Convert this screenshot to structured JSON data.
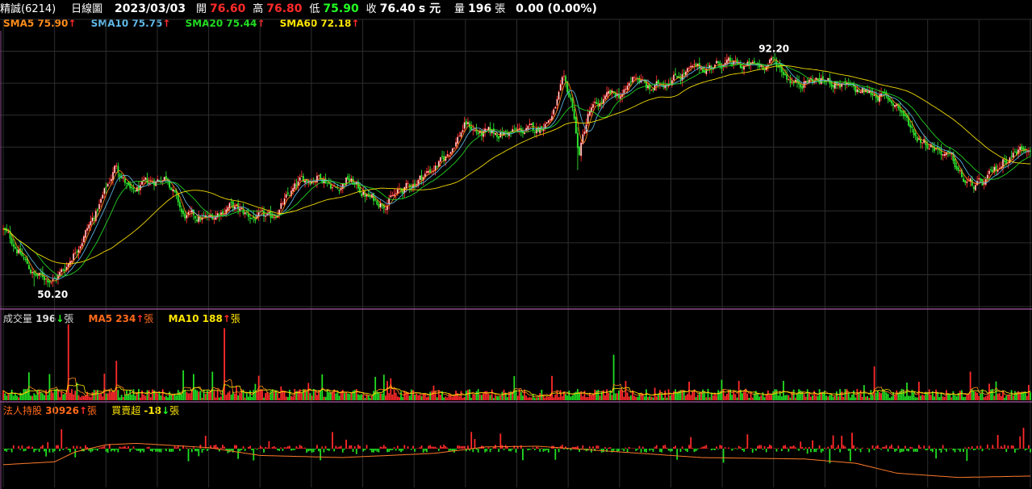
{
  "header": {
    "stock_name": "精誠(6214)",
    "period": "日線圖",
    "date": "2023/03/03",
    "open_label": "開",
    "open_value": "76.60",
    "high_label": "高",
    "high_value": "76.80",
    "low_label": "低",
    "low_value": "75.90",
    "close_label": "收",
    "close_value": "76.40",
    "close_unit": "s 元",
    "volume_label": "量",
    "volume_value": "196",
    "volume_unit": "張",
    "change": "0.00 (0.00%)"
  },
  "legend_main": [
    {
      "label": "SMA5",
      "value": "75.90",
      "arrow": "↑",
      "color": "#ff8c1a"
    },
    {
      "label": "SMA10",
      "value": "75.75",
      "arrow": "↑",
      "color": "#5fb8e8"
    },
    {
      "label": "SMA20",
      "value": "75.44",
      "arrow": "↑",
      "color": "#22dd22"
    },
    {
      "label": "SMA60",
      "value": "72.18",
      "arrow": "↑",
      "color": "#ffe600"
    }
  ],
  "legend_volume": {
    "vol_label": "成交量",
    "vol_value": "196",
    "vol_arrow": "↓",
    "vol_unit": "張",
    "ma5_label": "MA5",
    "ma5_value": "234",
    "ma5_arrow": "↑",
    "ma5_unit": "張",
    "ma10_label": "MA10",
    "ma10_value": "188",
    "ma10_arrow": "↑",
    "ma10_unit": "張"
  },
  "legend_institutional": {
    "hold_label": "法人持股",
    "hold_value": "30926",
    "hold_arrow": "↑",
    "hold_unit": "張",
    "net_label": "買賣超",
    "net_value": "-18",
    "net_arrow": "↓",
    "net_unit": "張"
  },
  "chart_data": [
    {
      "type": "line",
      "title": "",
      "description_of_series": "daily candlesticks with moving averages",
      "annotations": [
        {
          "label": "92.20",
          "kind": "high",
          "value": 92.2,
          "index_fraction": 0.75
        },
        {
          "label": "50.20",
          "kind": "low",
          "value": 50.2,
          "index_fraction": 0.03
        }
      ],
      "ylim": [
        46.5,
        97.0
      ],
      "anchors": [
        [
          0.0,
          60.5
        ],
        [
          0.01,
          58.2
        ],
        [
          0.03,
          52.2
        ],
        [
          0.05,
          51.5
        ],
        [
          0.06,
          53.5
        ],
        [
          0.09,
          63.5
        ],
        [
          0.11,
          72.5
        ],
        [
          0.125,
          67.0
        ],
        [
          0.14,
          69.0
        ],
        [
          0.16,
          70.5
        ],
        [
          0.175,
          63.0
        ],
        [
          0.2,
          62.5
        ],
        [
          0.22,
          65.0
        ],
        [
          0.24,
          63.0
        ],
        [
          0.26,
          62.5
        ],
        [
          0.29,
          69.5
        ],
        [
          0.31,
          70.5
        ],
        [
          0.325,
          68.0
        ],
        [
          0.335,
          70.0
        ],
        [
          0.355,
          66.5
        ],
        [
          0.37,
          65.5
        ],
        [
          0.395,
          68.5
        ],
        [
          0.43,
          73.5
        ],
        [
          0.45,
          80.0
        ],
        [
          0.465,
          78.0
        ],
        [
          0.5,
          78.5
        ],
        [
          0.52,
          79.0
        ],
        [
          0.535,
          81.5
        ],
        [
          0.545,
          87.5
        ],
        [
          0.555,
          83.0
        ],
        [
          0.56,
          74.0
        ],
        [
          0.57,
          82.0
        ],
        [
          0.59,
          85.0
        ],
        [
          0.605,
          85.5
        ],
        [
          0.615,
          89.0
        ],
        [
          0.63,
          86.0
        ],
        [
          0.65,
          88.5
        ],
        [
          0.675,
          90.0
        ],
        [
          0.7,
          91.0
        ],
        [
          0.72,
          90.5
        ],
        [
          0.735,
          90.5
        ],
        [
          0.75,
          91.5
        ],
        [
          0.77,
          87.5
        ],
        [
          0.79,
          88.0
        ],
        [
          0.81,
          87.5
        ],
        [
          0.83,
          86.0
        ],
        [
          0.85,
          85.5
        ],
        [
          0.87,
          83.5
        ],
        [
          0.89,
          77.5
        ],
        [
          0.91,
          75.5
        ],
        [
          0.925,
          73.0
        ],
        [
          0.935,
          69.5
        ],
        [
          0.945,
          68.5
        ],
        [
          0.955,
          69.0
        ],
        [
          0.975,
          73.5
        ],
        [
          1.0,
          76.4
        ]
      ]
    },
    {
      "type": "bar",
      "title": "成交量",
      "ylim": [
        0,
        1000
      ],
      "spikes": [
        {
          "index_fraction": 0.063,
          "value": 1000
        },
        {
          "index_fraction": 0.215,
          "value": 950
        },
        {
          "index_fraction": 0.595,
          "value": 600
        },
        {
          "index_fraction": 0.11,
          "value": 520
        }
      ]
    },
    {
      "type": "bar",
      "title": "法人持股 / 買賣超",
      "holdings_anchors": [
        [
          0.0,
          0.32
        ],
        [
          0.05,
          0.36
        ],
        [
          0.07,
          0.5
        ],
        [
          0.1,
          0.6
        ],
        [
          0.13,
          0.62
        ],
        [
          0.2,
          0.56
        ],
        [
          0.25,
          0.45
        ],
        [
          0.33,
          0.42
        ],
        [
          0.42,
          0.48
        ],
        [
          0.47,
          0.57
        ],
        [
          0.52,
          0.58
        ],
        [
          0.6,
          0.5
        ],
        [
          0.68,
          0.42
        ],
        [
          0.78,
          0.4
        ],
        [
          0.83,
          0.34
        ],
        [
          0.87,
          0.2
        ],
        [
          0.93,
          0.14
        ],
        [
          1.0,
          0.16
        ]
      ]
    }
  ]
}
